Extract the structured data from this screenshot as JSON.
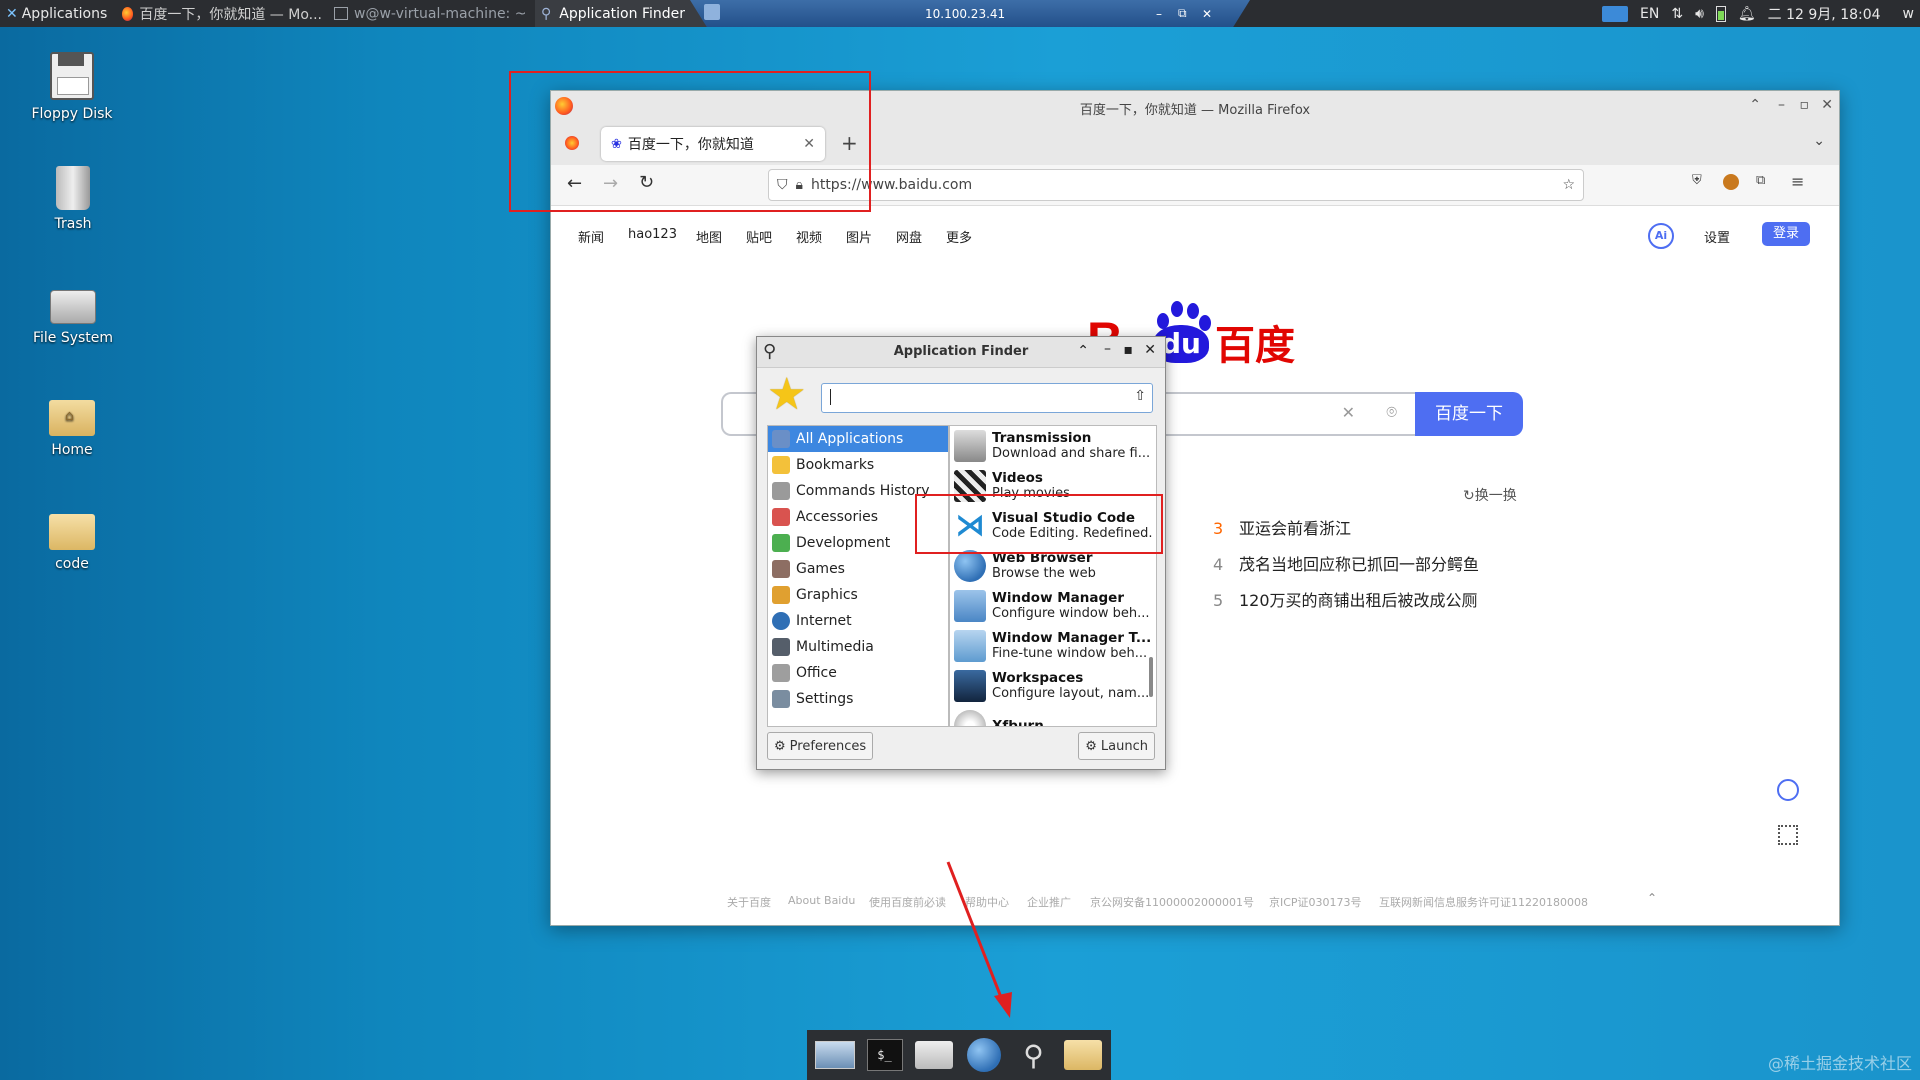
{
  "top_panel": {
    "apps_label": "Applications",
    "tasks": [
      {
        "label": "百度一下，你就知道 — Mo...",
        "active": false
      },
      {
        "label": "w@w-virtual-machine: ~",
        "active": false
      },
      {
        "label": "Application Finder",
        "active": true
      }
    ],
    "remote_ip": "10.100.23.41",
    "lang": "EN",
    "clock": "二 12 9月, 18:04",
    "user_initial": "w"
  },
  "desktop_icons": [
    {
      "label": "Floppy Disk"
    },
    {
      "label": "Trash"
    },
    {
      "label": "File System"
    },
    {
      "label": "Home"
    },
    {
      "label": "code"
    }
  ],
  "firefox": {
    "window_title": "百度一下，你就知道 — Mozilla Firefox",
    "tab_title": "百度一下，你就知道",
    "url": "https://www.baidu.com",
    "nav_links": [
      "新闻",
      "hao123",
      "地图",
      "贴吧",
      "视频",
      "图片",
      "网盘",
      "更多"
    ],
    "settings_label": "设置",
    "login_label": "登录",
    "search_button": "百度一下",
    "refresh_label": "换一换",
    "hot_items": [
      {
        "num": "3",
        "text": "亚运会前看浙江"
      },
      {
        "num": "4",
        "text": "茂名当地回应称已抓回一部分鳄鱼"
      },
      {
        "num": "5",
        "text": "120万买的商铺出租后被改成公厕"
      }
    ],
    "logo_text": "百度",
    "logo_du": "du",
    "footer_links": [
      "关于百度",
      "About Baidu",
      "使用百度前必读",
      "帮助中心",
      "企业推广",
      "京公网安备11000002000001号",
      "京ICP证030173号",
      "互联网新闻信息服务许可证11220180008"
    ]
  },
  "app_finder": {
    "title": "Application Finder",
    "categories": [
      {
        "label": "All Applications",
        "color": "#6a8fc7"
      },
      {
        "label": "Bookmarks",
        "color": "#f3c13a"
      },
      {
        "label": "Commands History",
        "color": "#9a9a9a"
      },
      {
        "label": "Accessories",
        "color": "#d9534f"
      },
      {
        "label": "Development",
        "color": "#4caf50"
      },
      {
        "label": "Games",
        "color": "#8d6e63"
      },
      {
        "label": "Graphics",
        "color": "#e0a030"
      },
      {
        "label": "Internet",
        "color": "#2f6fb5"
      },
      {
        "label": "Multimedia",
        "color": "#555e6a"
      },
      {
        "label": "Office",
        "color": "#9e9e9e"
      },
      {
        "label": "Settings",
        "color": "#7a8da0"
      }
    ],
    "apps": [
      {
        "name": "Transmission",
        "desc": "Download and share fi...",
        "color": "#888"
      },
      {
        "name": "Videos",
        "desc": "Play movies",
        "color": "#333"
      },
      {
        "name": "Visual Studio Code",
        "desc": "Code Editing. Redefined.",
        "color": "#1f8ad2"
      },
      {
        "name": "Web Browser",
        "desc": "Browse the web",
        "color": "#2f6fb5"
      },
      {
        "name": "Window Manager",
        "desc": "Configure window beh...",
        "color": "#5b9bd5"
      },
      {
        "name": "Window Manager T...",
        "desc": "Fine-tune window beh...",
        "color": "#6aa8d8"
      },
      {
        "name": "Workspaces",
        "desc": "Configure layout, nam...",
        "color": "#1e3a5f"
      },
      {
        "name": "Xfburn",
        "desc": "",
        "color": "#aaa"
      }
    ],
    "preferences_label": "Preferences",
    "launch_label": "Launch"
  },
  "watermark": "@稀土掘金技术社区"
}
